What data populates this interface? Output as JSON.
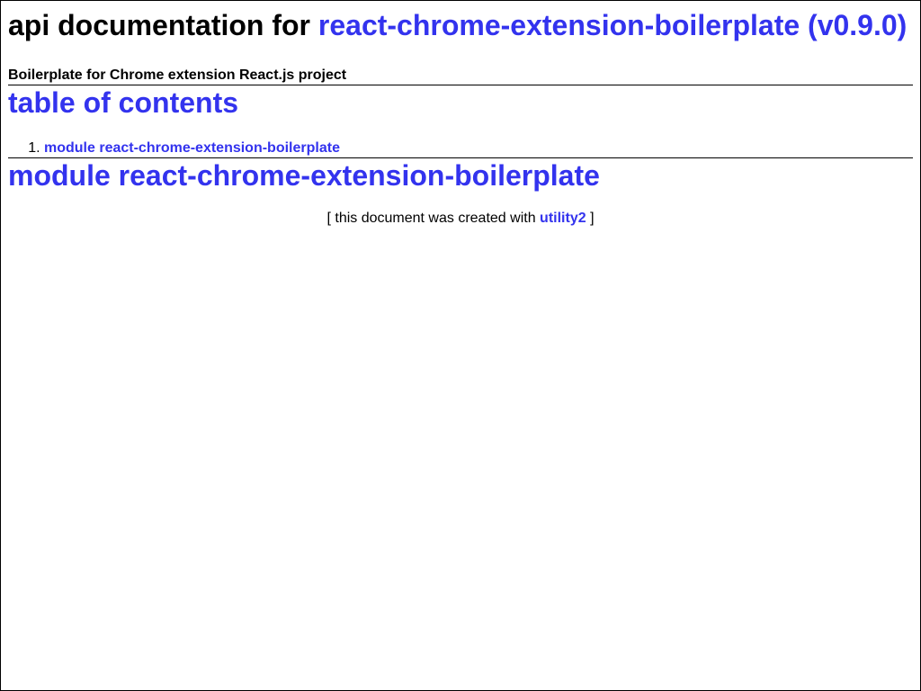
{
  "header": {
    "title_prefix": "api documentation for",
    "title_link": "react-chrome-extension-boilerplate (v0.9.0)",
    "description": "Boilerplate for Chrome extension React.js project"
  },
  "toc": {
    "title": "table of contents",
    "items": [
      {
        "number": "1.",
        "label": "module react-chrome-extension-boilerplate"
      }
    ]
  },
  "module": {
    "title": "module react-chrome-extension-boilerplate"
  },
  "footer": {
    "prefix": "[ this document was created with",
    "link": "utility2",
    "suffix": "]"
  },
  "colors": {
    "link": "#3333ee",
    "text": "#000000",
    "background": "#ffffff"
  }
}
